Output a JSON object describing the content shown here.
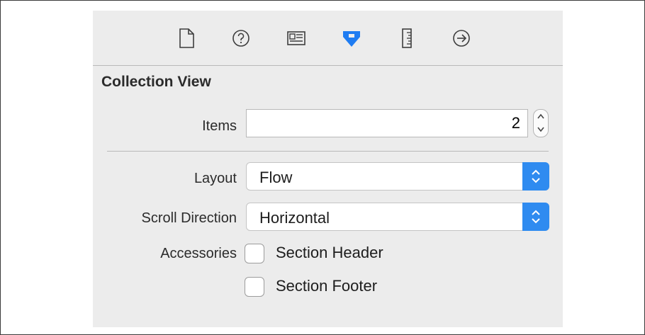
{
  "toolbar": {
    "icons": [
      "file-inspector-icon",
      "quick-help-icon",
      "identity-inspector-icon",
      "attributes-inspector-icon",
      "size-inspector-icon",
      "connections-inspector-icon"
    ],
    "active_color": "#1e7cf2"
  },
  "section": {
    "title": "Collection View"
  },
  "items": {
    "label": "Items",
    "value": "2"
  },
  "layout": {
    "label": "Layout",
    "value": "Flow"
  },
  "scroll_direction": {
    "label": "Scroll Direction",
    "value": "Horizontal"
  },
  "accessories": {
    "label": "Accessories",
    "options": [
      {
        "label": "Section Header",
        "checked": false
      },
      {
        "label": "Section Footer",
        "checked": false
      }
    ]
  },
  "colors": {
    "panel": "#ececec",
    "select_accent": "#2f8bf0"
  }
}
